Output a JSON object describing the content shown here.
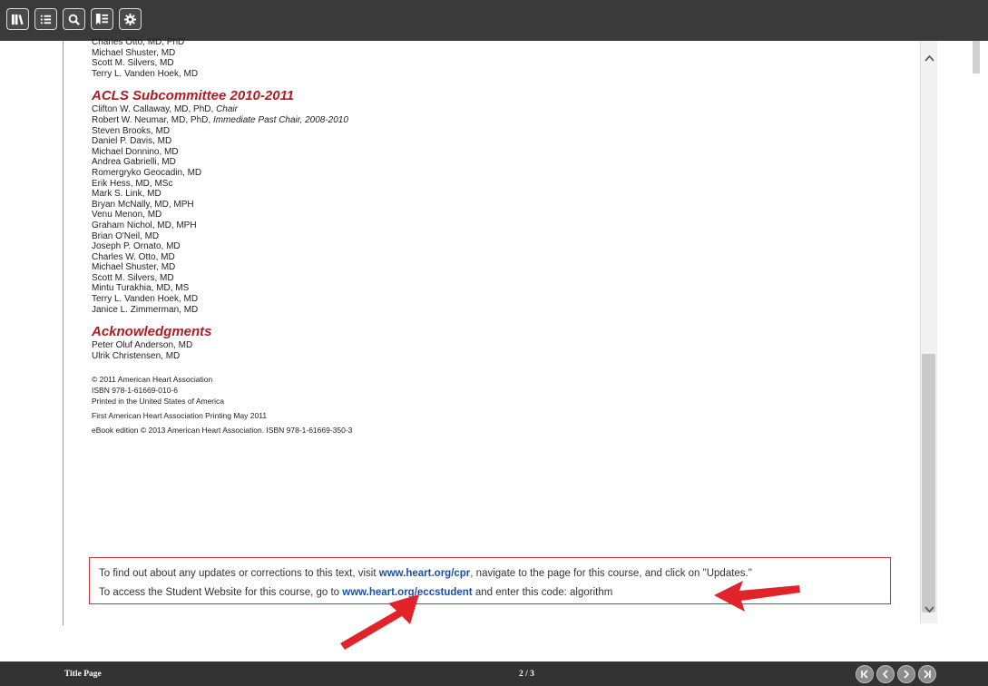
{
  "toolbar": {
    "buttons": [
      {
        "name": "bookshelf",
        "icon": "books-icon"
      },
      {
        "name": "table-of-contents",
        "icon": "list-icon"
      },
      {
        "name": "search",
        "icon": "search-icon"
      },
      {
        "name": "bookmarks",
        "icon": "bookmark-list-icon"
      },
      {
        "name": "settings",
        "icon": "gear-icon"
      }
    ]
  },
  "page": {
    "top_names": [
      "Charles Otto, MD, PhD",
      "Michael Shuster, MD",
      "Scott M. Silvers, MD",
      "Terry L. Vanden Hoek, MD"
    ],
    "acls_title": "ACLS Subcommittee 2010-2011",
    "acls_chair_name": "Clifton W. Callaway, MD, PhD, ",
    "acls_chair_role": "Chair",
    "acls_past_chair_name": "Robert W. Neumar, MD, PhD, ",
    "acls_past_chair_role": "Immediate Past Chair, 2008-2010",
    "acls_members": [
      "Steven Brooks, MD",
      "Daniel P. Davis, MD",
      "Michael Donnino, MD",
      "Andrea Gabrielli, MD",
      "Romergryko Geocadin, MD",
      "Erik Hess, MD, MSc",
      "Mark S. Link, MD",
      "Bryan McNally, MD, MPH",
      "Venu Menon, MD",
      "Graham Nichol, MD, MPH",
      "Brian O'Neil, MD",
      "Joseph P. Ornato, MD",
      "Charles W. Otto, MD",
      "Michael Shuster, MD",
      "Scott M. Silvers, MD",
      "Mintu Turakhia, MD, MS",
      "Terry L. Vanden Hoek, MD",
      "Janice L. Zimmerman, MD"
    ],
    "ack_title": "Acknowledgments",
    "ack_names": [
      "Peter Oluf Anderson, MD",
      "Ulrik Christensen, MD"
    ],
    "copyright_lines": [
      "© 2011 American Heart Association",
      "ISBN 978-1-61669-010-6",
      "Printed in the United States of America",
      "First American Heart Association Printing May 2011",
      "eBook edition © 2013 American Heart Association. ISBN 978-1-61669-350-3"
    ],
    "notice": {
      "line1_before": "To find out about any updates or corrections to this text, visit ",
      "line1_link": "www.heart.org/cpr",
      "line1_after": ", navigate to the page for this course, and click on \"Updates.\"",
      "line2_before": "To access the Student Website for this course, go to ",
      "line2_link": "www.heart.org/eccstudent",
      "line2_after": " and enter this code: algorithm"
    }
  },
  "footer": {
    "title": "Title Page",
    "page_indicator": "2 / 3",
    "nav": [
      "first-page",
      "previous-page",
      "next-page",
      "last-page"
    ]
  },
  "colors": {
    "section_title": "#b01c24",
    "link": "#1a4fa8",
    "toolbar_bg": "#3a3a3a",
    "annotation_arrow": "#e0242a"
  }
}
